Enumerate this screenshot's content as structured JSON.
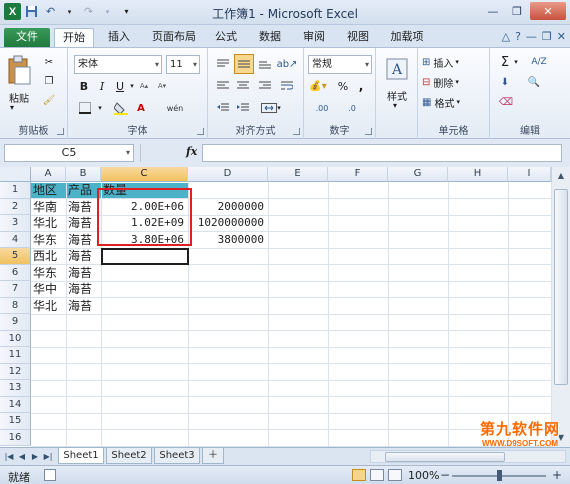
{
  "window": {
    "title": "工作簿1 - Microsoft Excel"
  },
  "ribbon_tabs": [
    "文件",
    "开始",
    "插入",
    "页面布局",
    "公式",
    "数据",
    "审阅",
    "视图",
    "加载项"
  ],
  "clipboard": {
    "paste_label": "粘贴",
    "group_label": "剪贴板"
  },
  "font": {
    "name": "宋体",
    "size": "11",
    "group_label": "字体",
    "bold": "B",
    "italic": "I",
    "underline": "U",
    "font_color_glyph": "A",
    "phonetic": "wén"
  },
  "alignment": {
    "group_label": "对齐方式"
  },
  "number": {
    "format": "常规",
    "group_label": "数字",
    "percent": "%",
    "comma": ",",
    "increase": ".00",
    "decrease": ".0"
  },
  "styles": {
    "label": "样式"
  },
  "cells": {
    "insert": "插入",
    "delete": "删除",
    "format": "格式",
    "group_label": "单元格"
  },
  "editing": {
    "group_label": "编辑",
    "sum": "Σ",
    "sort": "A/Z"
  },
  "formula_bar": {
    "name_box": "C5",
    "fx": "fx",
    "formula": ""
  },
  "columns": [
    "A",
    "B",
    "C",
    "D",
    "E",
    "F",
    "G",
    "H",
    "I"
  ],
  "rows": [
    "1",
    "2",
    "3",
    "4",
    "5",
    "6",
    "7",
    "8",
    "9",
    "10",
    "11",
    "12",
    "13",
    "14",
    "15",
    "16"
  ],
  "cells_data": {
    "A1": "地区",
    "B1": "产品",
    "C1": "数量",
    "A2": "华南",
    "B2": "海苔",
    "C2": "2.00E+06",
    "D2": "2000000",
    "A3": "华北",
    "B3": "海苔",
    "C3": "1.02E+09",
    "D3": "1020000000",
    "A4": "华东",
    "B4": "海苔",
    "C4": "3.80E+06",
    "D4": "3800000",
    "A5": "西北",
    "B5": "海苔",
    "A6": "华东",
    "B6": "海苔",
    "A7": "华中",
    "B7": "海苔",
    "A8": "华北",
    "B8": "海苔"
  },
  "sheets": [
    "Sheet1",
    "Sheet2",
    "Sheet3"
  ],
  "status": {
    "ready": "就绪",
    "zoom": "100%"
  },
  "watermark": {
    "big": "第九软件网",
    "small": "WWW.D9SOFT.COM"
  },
  "colors": {
    "header_fill": "#4cb2c8",
    "highlight_border": "#e02020",
    "file_tab": "#1f7a3d"
  }
}
